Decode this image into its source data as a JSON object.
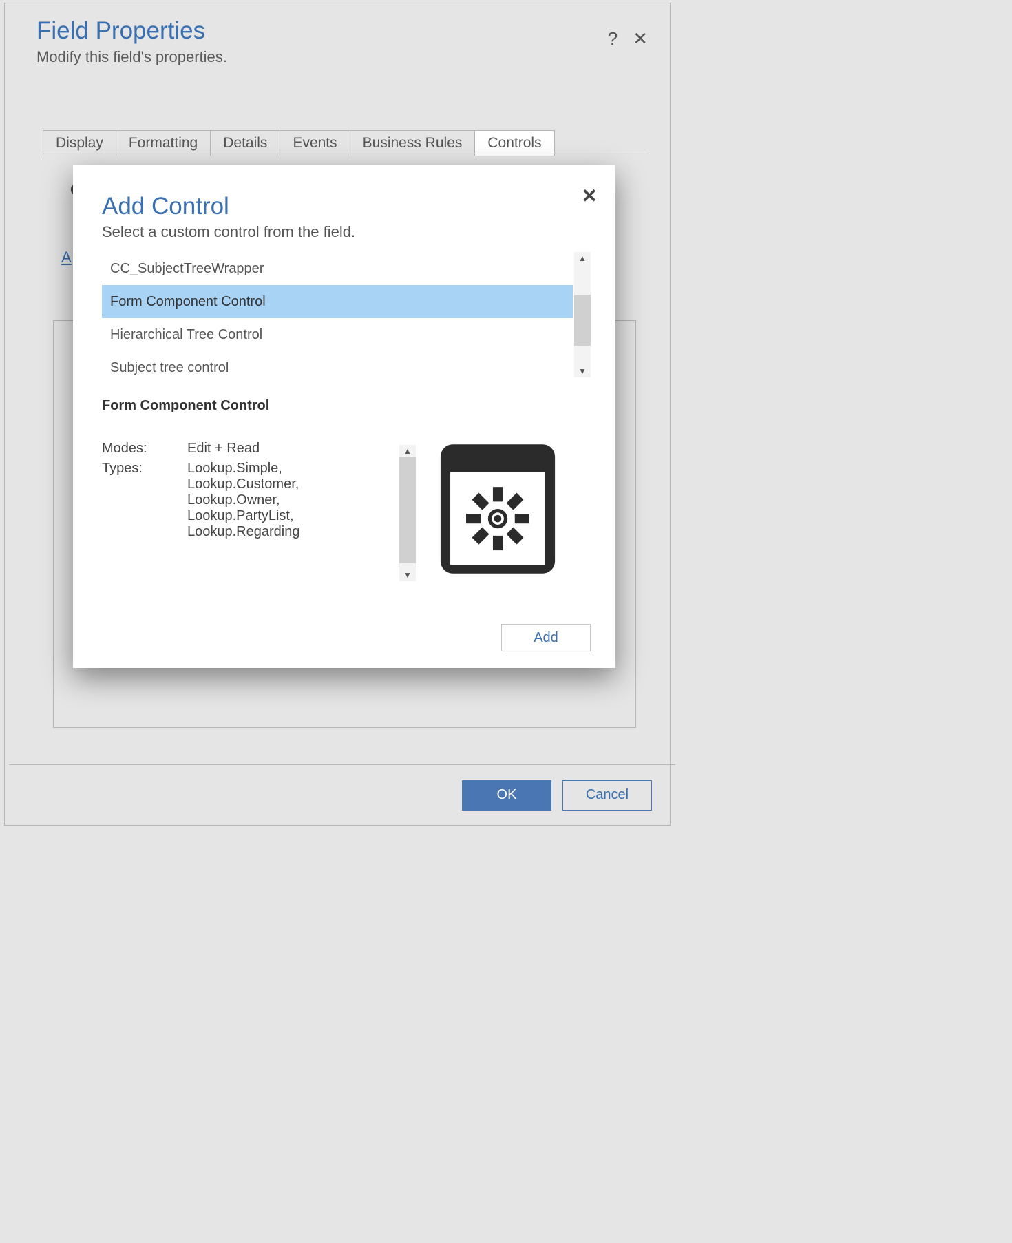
{
  "fieldProperties": {
    "title": "Field Properties",
    "subtitle": "Modify this field's properties.",
    "tabs": [
      "Display",
      "Formatting",
      "Details",
      "Events",
      "Business Rules",
      "Controls"
    ],
    "activeTabIndex": 5,
    "cutoffLetter": "C",
    "cutoffLetter2": "A",
    "footer": {
      "ok_label": "OK",
      "cancel_label": "Cancel"
    }
  },
  "addControl": {
    "title": "Add Control",
    "subtitle": "Select a custom control from the field.",
    "items": [
      "CC_SubjectTreeWrapper",
      "Form Component Control",
      "Hierarchical Tree Control",
      "Subject tree control"
    ],
    "selectedIndex": 1,
    "detail": {
      "name": "Form Component Control",
      "modes_label": "Modes:",
      "modes_value": "Edit + Read",
      "types_label": "Types:",
      "types_value": "Lookup.Simple, Lookup.Customer, Lookup.Owner, Lookup.PartyList, Lookup.Regarding"
    },
    "add_label": "Add"
  }
}
